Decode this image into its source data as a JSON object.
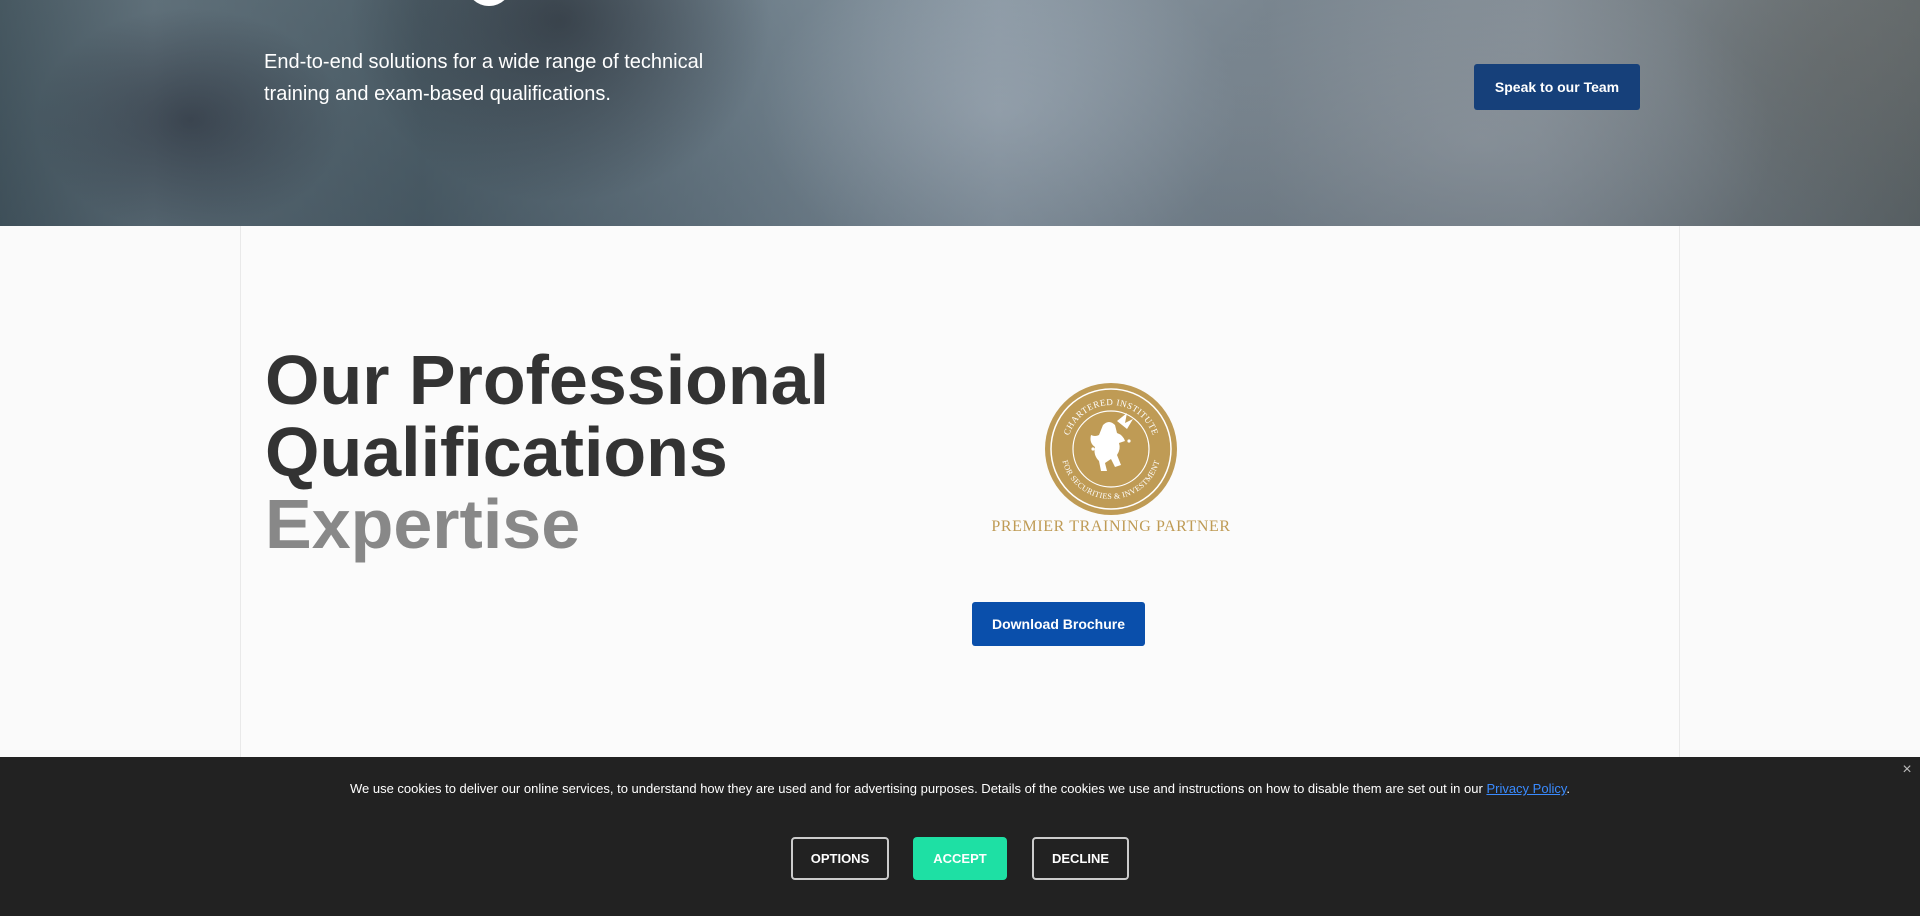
{
  "hero": {
    "subtitle": "End-to-end solutions for a wide range of technical training and exam-based qualifications.",
    "cta_label": "Speak to our Team"
  },
  "qualifications": {
    "title_line1": "Our Professional",
    "title_line2": "Qualifications",
    "title_line3": "Expertise",
    "partner_text": "PREMIER TRAINING PARTNER",
    "seal_top_text": "CHARTERED INSTITUTE",
    "seal_bottom_text": "FOR SECURITIES & INVESTMENT",
    "download_label": "Download Brochure"
  },
  "cookie": {
    "message": "We use cookies to deliver our online services, to understand how they are used and for advertising purposes. Details of the cookies we use and instructions on how to disable them are set out in our",
    "link_text": "Privacy Policy",
    "trailing": ".",
    "close_icon": "×",
    "options_label": "OPTIONS",
    "accept_label": "ACCEPT",
    "decline_label": "DECLINE"
  },
  "colors": {
    "brand_navy": "#16407a",
    "brand_blue": "#0a4fab",
    "gold": "#bf9b55",
    "accept_green": "#1ee0a4",
    "cookie_bg": "#222222"
  }
}
